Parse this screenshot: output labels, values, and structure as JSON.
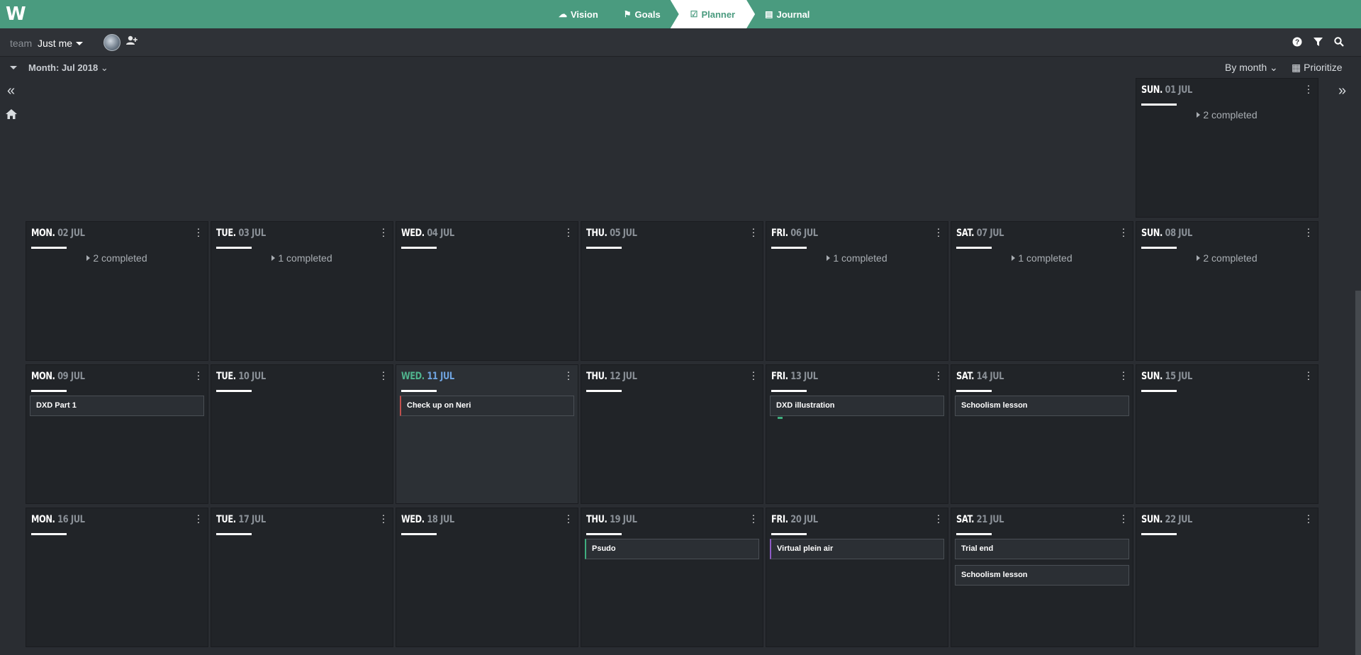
{
  "topbar": {
    "logo": "W",
    "nav": [
      {
        "label": "Vision",
        "icon": "cloud-icon",
        "glyph": "☁",
        "active": false
      },
      {
        "label": "Goals",
        "icon": "flag-icon",
        "glyph": "⚑",
        "active": false
      },
      {
        "label": "Planner",
        "icon": "calendar-check-icon",
        "glyph": "☑",
        "active": true
      },
      {
        "label": "Journal",
        "icon": "book-icon",
        "glyph": "▤",
        "active": false
      }
    ]
  },
  "subbar": {
    "team_label": "team",
    "team_value": "Just me",
    "icons": [
      "help-icon",
      "filter-icon",
      "search-icon"
    ]
  },
  "viewbar": {
    "month_label": "Month:",
    "month_value": "Jul 2018",
    "by_month": "By month",
    "prioritize": "Prioritize"
  },
  "calendar": {
    "weeks": [
      [
        null,
        null,
        null,
        null,
        null,
        null,
        {
          "dow": "SUN.",
          "date": "01 JUL",
          "completed": "2 completed",
          "tasks": []
        }
      ],
      [
        {
          "dow": "MON.",
          "date": "02 JUL",
          "completed": "2 completed",
          "tasks": []
        },
        {
          "dow": "TUE.",
          "date": "03 JUL",
          "completed": "1 completed",
          "tasks": []
        },
        {
          "dow": "WED.",
          "date": "04 JUL",
          "completed": "",
          "tasks": []
        },
        {
          "dow": "THU.",
          "date": "05 JUL",
          "completed": "",
          "tasks": []
        },
        {
          "dow": "FRI.",
          "date": "06 JUL",
          "completed": "1 completed",
          "tasks": []
        },
        {
          "dow": "SAT.",
          "date": "07 JUL",
          "completed": "1 completed",
          "tasks": []
        },
        {
          "dow": "SUN.",
          "date": "08 JUL",
          "completed": "2 completed",
          "tasks": []
        }
      ],
      [
        {
          "dow": "MON.",
          "date": "09 JUL",
          "completed": "",
          "tasks": [
            {
              "label": "DXD Part 1",
              "accent": ""
            }
          ]
        },
        {
          "dow": "TUE.",
          "date": "10 JUL",
          "completed": "",
          "tasks": []
        },
        {
          "dow": "WED.",
          "date": "11 JUL",
          "completed": "",
          "today": true,
          "tasks": [
            {
              "label": "Check up on Neri",
              "accent": "red"
            }
          ]
        },
        {
          "dow": "THU.",
          "date": "12 JUL",
          "completed": "",
          "tasks": []
        },
        {
          "dow": "FRI.",
          "date": "13 JUL",
          "completed": "",
          "tasks": [
            {
              "label": "DXD illustration",
              "accent": "green-bar"
            }
          ]
        },
        {
          "dow": "SAT.",
          "date": "14 JUL",
          "completed": "",
          "tasks": [
            {
              "label": "Schoolism lesson",
              "accent": ""
            }
          ]
        },
        {
          "dow": "SUN.",
          "date": "15 JUL",
          "completed": "",
          "tasks": []
        }
      ],
      [
        {
          "dow": "MON.",
          "date": "16 JUL",
          "completed": "",
          "tasks": []
        },
        {
          "dow": "TUE.",
          "date": "17 JUL",
          "completed": "",
          "tasks": []
        },
        {
          "dow": "WED.",
          "date": "18 JUL",
          "completed": "",
          "tasks": []
        },
        {
          "dow": "THU.",
          "date": "19 JUL",
          "completed": "",
          "tasks": [
            {
              "label": "Psudo",
              "accent": "green"
            }
          ]
        },
        {
          "dow": "FRI.",
          "date": "20 JUL",
          "completed": "",
          "tasks": [
            {
              "label": "Virtual plein air",
              "accent": "purple"
            }
          ]
        },
        {
          "dow": "SAT.",
          "date": "21 JUL",
          "completed": "",
          "tasks": [
            {
              "label": "Trial end",
              "accent": ""
            },
            {
              "label": "Schoolism lesson",
              "accent": ""
            }
          ]
        },
        {
          "dow": "SUN.",
          "date": "22 JUL",
          "completed": "",
          "tasks": []
        }
      ]
    ]
  }
}
